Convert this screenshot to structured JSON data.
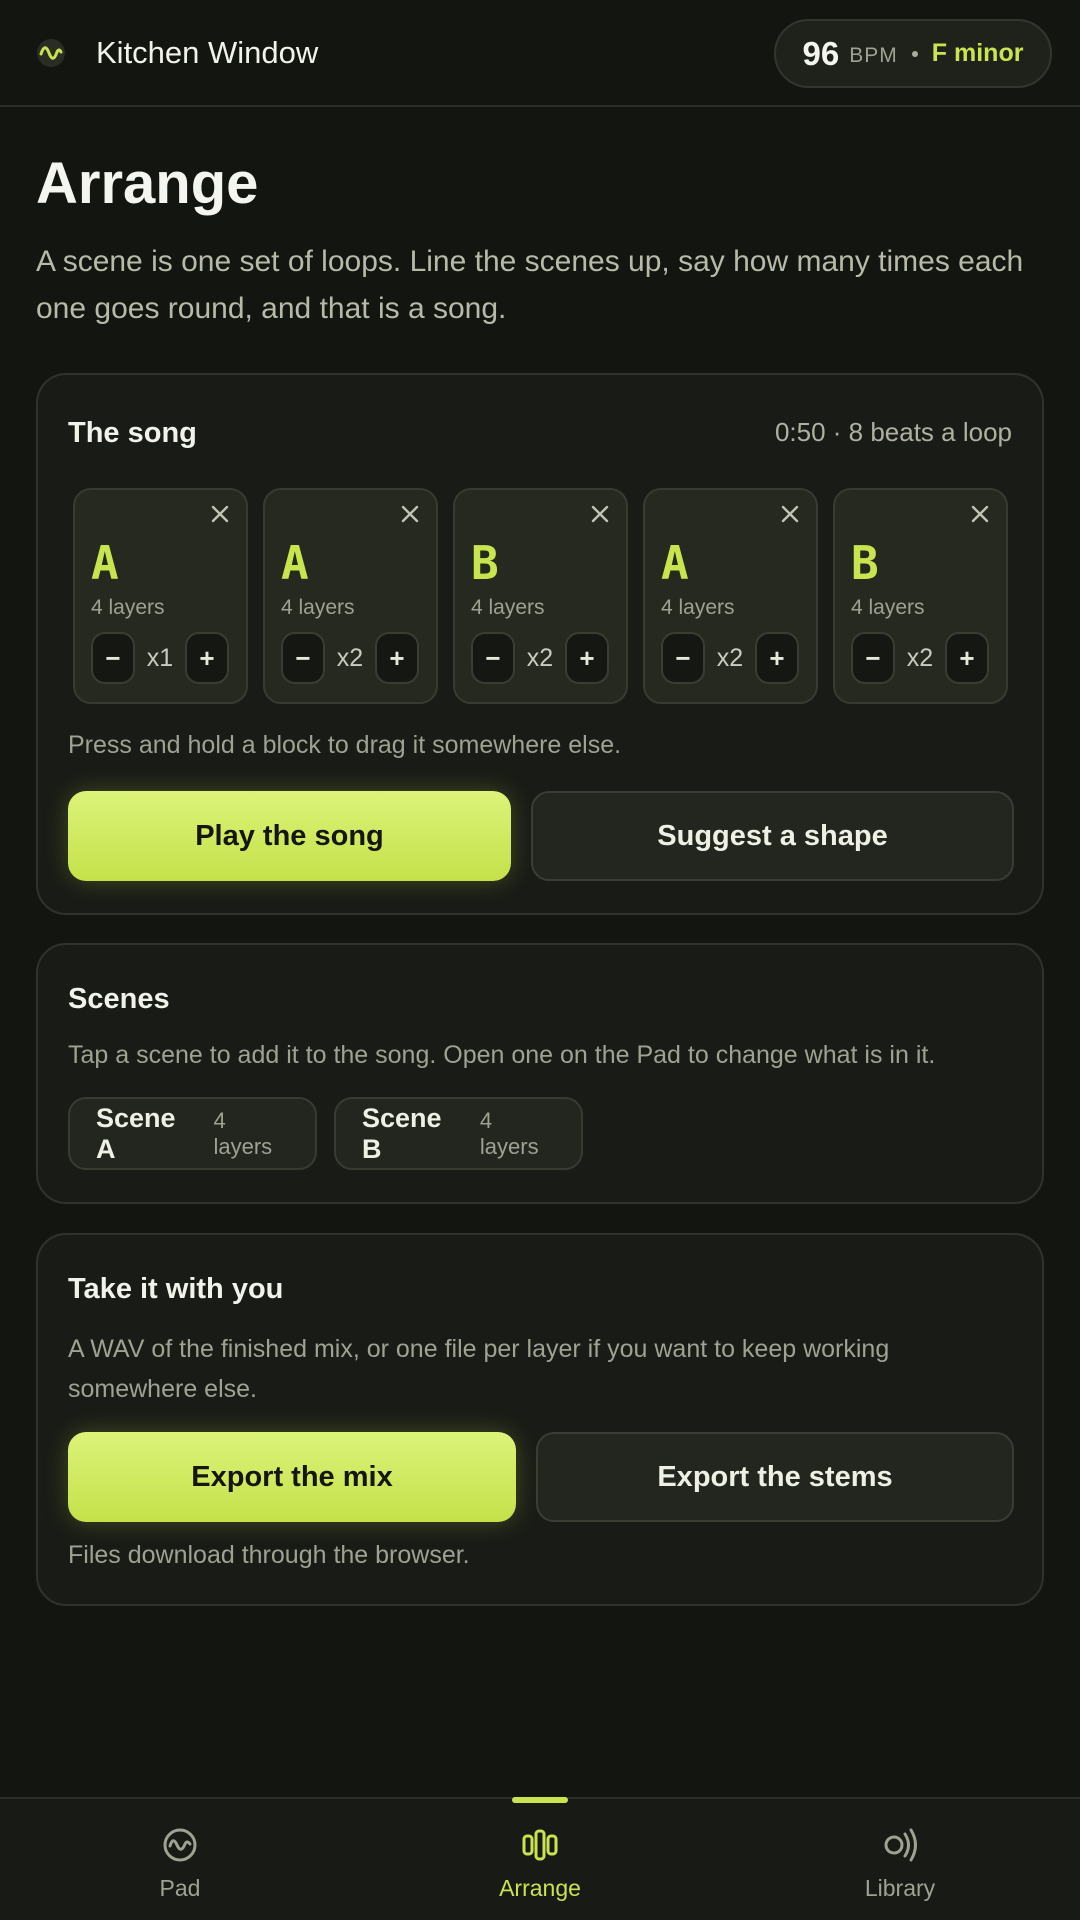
{
  "header": {
    "app_title": "Kitchen Window",
    "bpm": "96",
    "bpm_unit": "BPM",
    "key": "F minor"
  },
  "page": {
    "title": "Arrange",
    "description": "A scene is one set of loops. Line the scenes up, say how many times each one goes round, and that is a song."
  },
  "song": {
    "title": "The song",
    "meta": "0:50 · 8 beats a loop",
    "blocks": [
      {
        "letter": "A",
        "layers": "4 layers",
        "count": "x1"
      },
      {
        "letter": "A",
        "layers": "4 layers",
        "count": "x2"
      },
      {
        "letter": "B",
        "layers": "4 layers",
        "count": "x2"
      },
      {
        "letter": "A",
        "layers": "4 layers",
        "count": "x2"
      },
      {
        "letter": "B",
        "layers": "4 layers",
        "count": "x2"
      }
    ],
    "minus_label": "−",
    "plus_label": "+",
    "hint": "Press and hold a block to drag it somewhere else.",
    "play_label": "Play the song",
    "suggest_label": "Suggest a shape"
  },
  "scenes": {
    "title": "Scenes",
    "description": "Tap a scene to add it to the song. Open one on the Pad to change what is in it.",
    "items": [
      {
        "name": "Scene A",
        "layers": "4 layers"
      },
      {
        "name": "Scene B",
        "layers": "4 layers"
      }
    ]
  },
  "export": {
    "title": "Take it with you",
    "description": "A WAV of the finished mix, or one file per layer if you want to keep working somewhere else.",
    "mix_label": "Export the mix",
    "stems_label": "Export the stems",
    "note": "Files download through the browser."
  },
  "nav": {
    "items": [
      {
        "label": "Pad",
        "icon": "pad-wave-icon"
      },
      {
        "label": "Arrange",
        "icon": "arrange-bars-icon"
      },
      {
        "label": "Library",
        "icon": "library-broadcast-icon"
      }
    ],
    "active": "Arrange"
  },
  "colors": {
    "accent": "#c8e44e",
    "background": "#131510",
    "card": "#191b16"
  }
}
